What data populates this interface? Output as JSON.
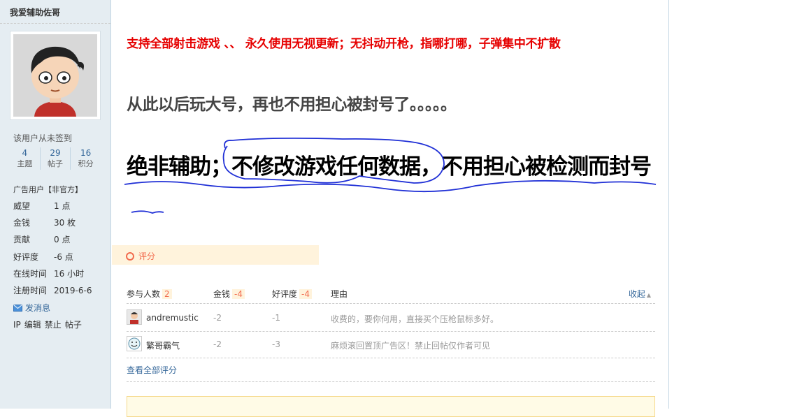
{
  "sidebar": {
    "username": "我爱辅助佐哥",
    "signin_note": "该用户从未签到",
    "stats": [
      {
        "num": "4",
        "label": "主题"
      },
      {
        "num": "29",
        "label": "帖子"
      },
      {
        "num": "16",
        "label": "积分"
      }
    ],
    "role": "广告用户【非官方】",
    "info": [
      {
        "key": "威望",
        "value": "1 点"
      },
      {
        "key": "金钱",
        "value": "30 枚"
      },
      {
        "key": "贡献",
        "value": "0 点"
      },
      {
        "key": "好评度",
        "value": "-6 点"
      },
      {
        "key": "在线时间",
        "value": "16 小时"
      },
      {
        "key": "注册时间",
        "value": "2019-6-6"
      }
    ],
    "send_message": "发消息",
    "tools": [
      "IP",
      "编辑",
      "禁止",
      "帖子"
    ]
  },
  "post": {
    "line1": "支持全部射击游戏 、、 永久使用无视更新；无抖动开枪，指哪打哪，子弹集中不扩散",
    "line2": "从此以后玩大号，再也不用担心被封号了。。。。。",
    "line3": "绝非辅助；不修改游戏任何数据，不用担心被检测而封号"
  },
  "rating": {
    "title": "评分",
    "headers": {
      "participants": "参与人数",
      "participants_count": "2",
      "money": "金钱",
      "money_total": "-4",
      "goodrate": "好评度",
      "goodrate_total": "-4",
      "reason": "理由",
      "collapse": "收起"
    },
    "rows": [
      {
        "user": "andremustic",
        "money": "-2",
        "goodrate": "-1",
        "reason": "收费的，要你何用，直接买个压枪鼠标多好。"
      },
      {
        "user": "繁哥霸气",
        "money": "-2",
        "goodrate": "-3",
        "reason": "麻烦滚回置顶广告区！禁止回帖仅作者可见"
      }
    ],
    "view_all": "查看全部评分"
  },
  "colors": {
    "sidebar_bg": "#e5edf2",
    "red_text": "#e60000",
    "accent": "#f26c4f",
    "link": "#336699",
    "doodle_blue": "#1f2fd6"
  }
}
